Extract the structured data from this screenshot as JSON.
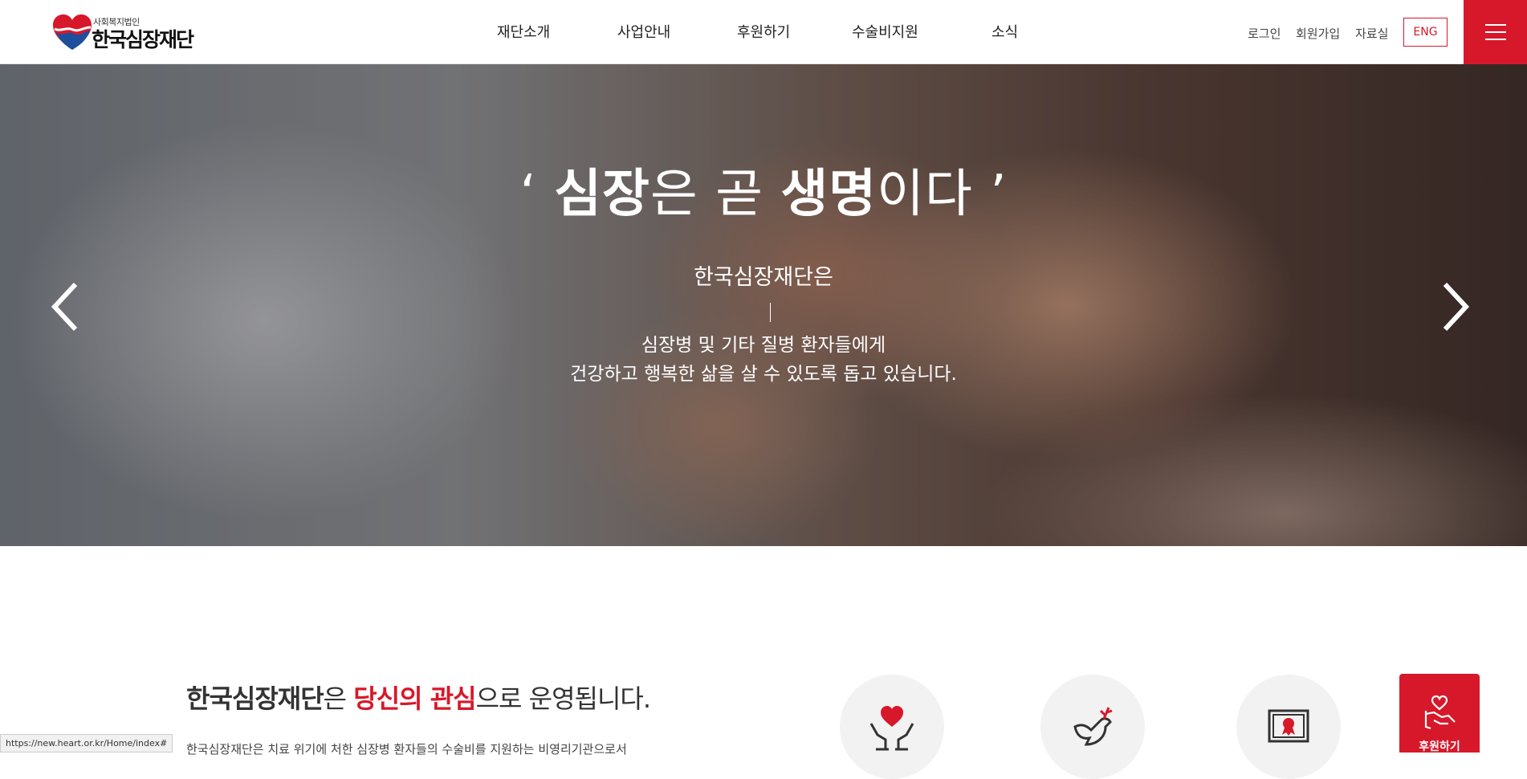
{
  "header": {
    "logo_small": "사회복지법인",
    "logo_main": "한국심장재단",
    "nav": [
      "재단소개",
      "사업안내",
      "후원하기",
      "수술비지원",
      "소식"
    ],
    "util": {
      "login": "로그인",
      "join": "회원가입",
      "archive": "자료실",
      "lang": "ENG"
    }
  },
  "hero": {
    "quote_open": "‘ ",
    "word1": "심장",
    "mid": "은 곧 ",
    "word2": "생명",
    "end": "이다 ’",
    "subtitle": "한국심장재단은",
    "desc_line1": "심장병 및 기타 질병 환자들에게",
    "desc_line2": "건강하고 행복한 삶을 살 수 있도록 돕고 있습니다."
  },
  "intro": {
    "strong": "한국심장재단",
    "part1": "은 ",
    "em": "당신의 관심",
    "part2": "으로 운영됩니다.",
    "text": "한국심장재단은 치료 위기에 처한 심장병 환자들의 수술비를 지원하는 비영리기관으로서"
  },
  "donate": {
    "label": "후원하기"
  },
  "status_bar": {
    "url": "https://new.heart.or.kr/Home/index#"
  },
  "colors": {
    "brand_red": "#d7182a"
  }
}
